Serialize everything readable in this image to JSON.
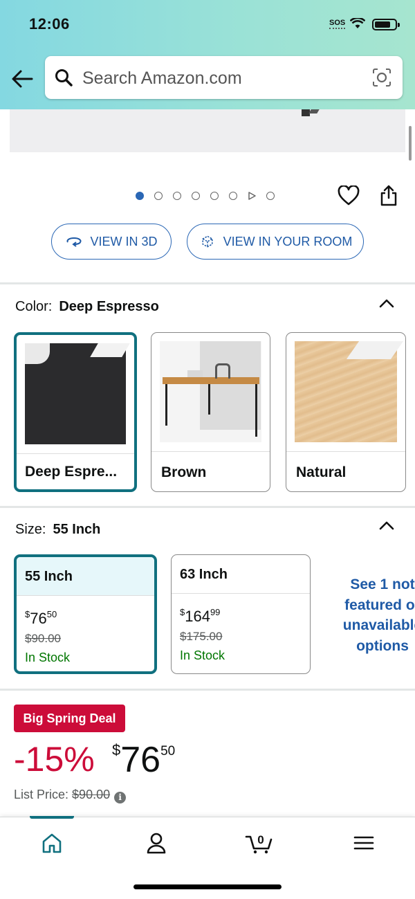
{
  "status_bar": {
    "time": "12:06",
    "sos": "SOS"
  },
  "search": {
    "placeholder": "Search Amazon.com"
  },
  "gallery": {
    "image_count": 8,
    "active_index": 0
  },
  "buttons": {
    "view_3d": "VIEW IN 3D",
    "view_room": "VIEW IN YOUR ROOM"
  },
  "color": {
    "label": "Color:",
    "selected": "Deep Espresso",
    "options": [
      {
        "name": "Deep Espre..."
      },
      {
        "name": "Brown"
      },
      {
        "name": "Natural"
      }
    ]
  },
  "size": {
    "label": "Size:",
    "selected": "55 Inch",
    "options": [
      {
        "name": "55 Inch",
        "currency": "$",
        "whole": "76",
        "cents": "50",
        "list": "$90.00",
        "stock": "In Stock"
      },
      {
        "name": "63 Inch",
        "currency": "$",
        "whole": "164",
        "cents": "99",
        "list": "$175.00",
        "stock": "In Stock"
      }
    ],
    "see_more": [
      "See 1 not",
      "featured or",
      "unavailable",
      "options"
    ]
  },
  "deal": {
    "badge": "Big Spring Deal",
    "discount": "-15%",
    "currency": "$",
    "whole": "76",
    "cents": "50",
    "list_label": "List Price:",
    "list_value": "$90.00",
    "info": "i"
  },
  "nav": {
    "cart_count": "0"
  },
  "colors": {
    "accent": "#10707f",
    "link": "#1f5aa6",
    "deal": "#cc0c39",
    "stock": "#007600"
  }
}
